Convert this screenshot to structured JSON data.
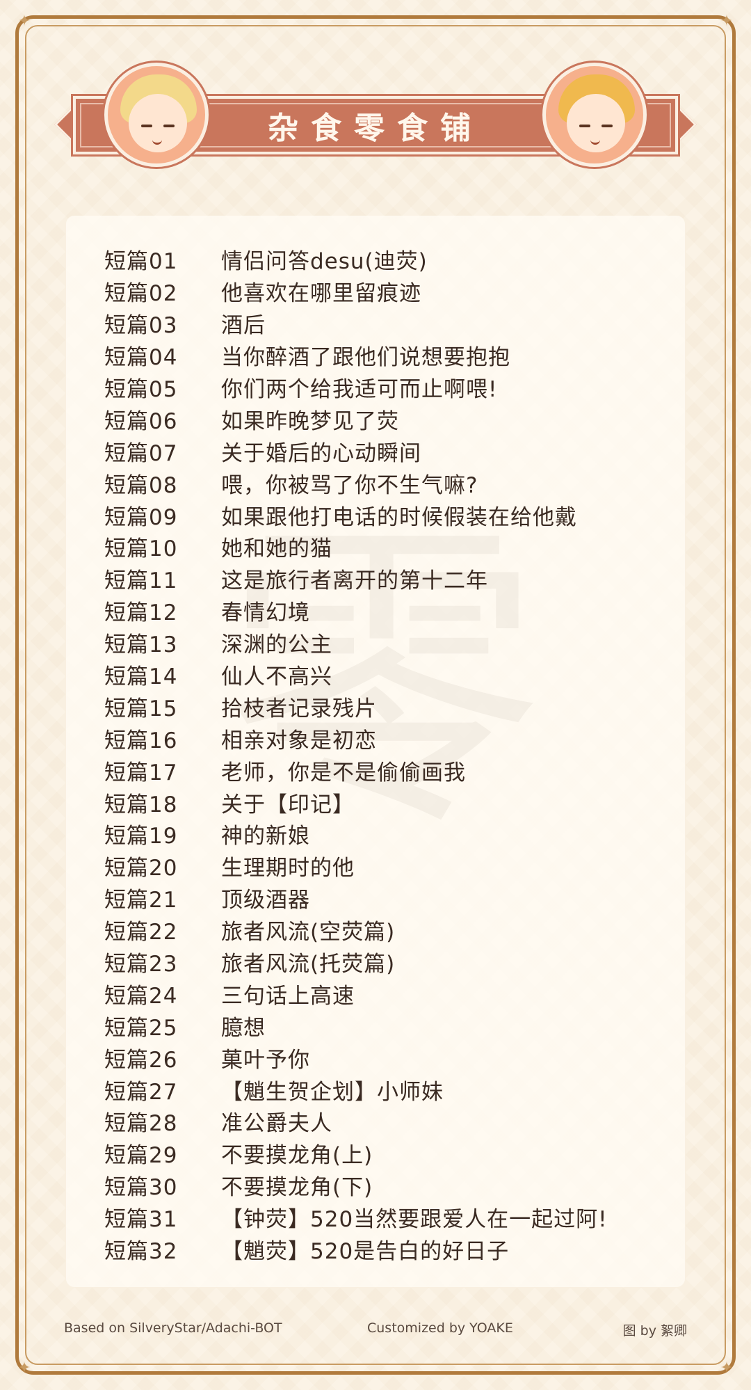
{
  "header": {
    "title": "杂食零食铺"
  },
  "items": [
    {
      "number": "短篇01",
      "title": "情侣问答desu(迪荧)"
    },
    {
      "number": "短篇02",
      "title": "他喜欢在哪里留痕迹"
    },
    {
      "number": "短篇03",
      "title": "酒后"
    },
    {
      "number": "短篇04",
      "title": "当你醉酒了跟他们说想要抱抱"
    },
    {
      "number": "短篇05",
      "title": "你们两个给我适可而止啊喂!"
    },
    {
      "number": "短篇06",
      "title": "如果昨晚梦见了荧"
    },
    {
      "number": "短篇07",
      "title": "关于婚后的心动瞬间"
    },
    {
      "number": "短篇08",
      "title": "喂，你被骂了你不生气嘛?"
    },
    {
      "number": "短篇09",
      "title": "如果跟他打电话的时候假装在给他戴"
    },
    {
      "number": "短篇10",
      "title": "她和她的猫"
    },
    {
      "number": "短篇11",
      "title": "这是旅行者离开的第十二年"
    },
    {
      "number": "短篇12",
      "title": "春情幻境"
    },
    {
      "number": "短篇13",
      "title": "深渊的公主"
    },
    {
      "number": "短篇14",
      "title": "仙人不高兴"
    },
    {
      "number": "短篇15",
      "title": "拾枝者记录残片"
    },
    {
      "number": "短篇16",
      "title": "相亲对象是初恋"
    },
    {
      "number": "短篇17",
      "title": "老师，你是不是偷偷画我"
    },
    {
      "number": "短篇18",
      "title": "关于【印记】"
    },
    {
      "number": "短篇19",
      "title": "神的新娘"
    },
    {
      "number": "短篇20",
      "title": "生理期时的他"
    },
    {
      "number": "短篇21",
      "title": "顶级酒器"
    },
    {
      "number": "短篇22",
      "title": "旅者风流(空荧篇)"
    },
    {
      "number": "短篇23",
      "title": "旅者风流(托荧篇)"
    },
    {
      "number": "短篇24",
      "title": "三句话上高速"
    },
    {
      "number": "短篇25",
      "title": "臆想"
    },
    {
      "number": "短篇26",
      "title": "菓叶予你"
    },
    {
      "number": "短篇27",
      "title": "【魈生贺企划】小师妹"
    },
    {
      "number": "短篇28",
      "title": "准公爵夫人"
    },
    {
      "number": "短篇29",
      "title": "不要摸龙角(上)"
    },
    {
      "number": "短篇30",
      "title": "不要摸龙角(下)"
    },
    {
      "number": "短篇31",
      "title": "【钟荧】520当然要跟爱人在一起过阿!"
    },
    {
      "number": "短篇32",
      "title": "【魈荧】520是告白的好日子"
    }
  ],
  "footer": {
    "left": "Based on SilveryStar/Adachi-BOT",
    "center": "Customized by YOAKE",
    "right": "图 by 絮卿"
  },
  "colors": {
    "background": "#fbf3e6",
    "frame": "#b07a3c",
    "banner": "#c9765c",
    "text": "#3a2a22"
  },
  "icons": {
    "corner": "sparkle-icon",
    "avatar_left": "lumine-avatar",
    "avatar_right": "aether-avatar"
  }
}
